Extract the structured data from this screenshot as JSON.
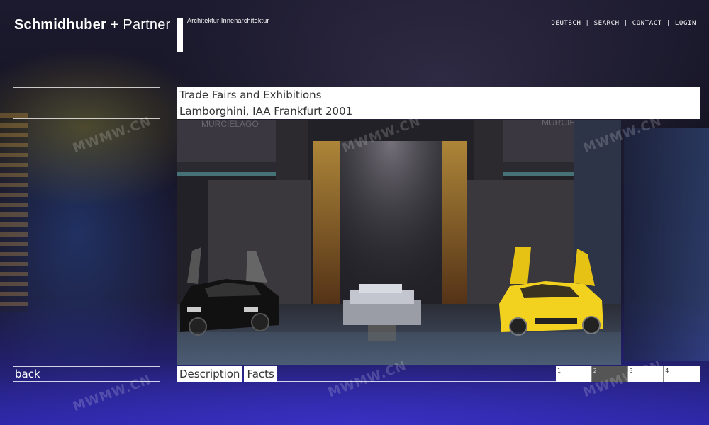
{
  "brand": {
    "name_bold": "Schmidhuber",
    "name_rest": "+ Partner",
    "tagline": "Architektur  Innenarchitektur"
  },
  "nav": {
    "items": [
      "DEUTSCH",
      "SEARCH",
      "CONTACT",
      "LOGIN"
    ],
    "separator": "|"
  },
  "category": "Trade Fairs and Exhibitions",
  "project": "Lamborghini, IAA Frankfurt 2001",
  "photo": {
    "alt": "Lamborghini",
    "signs": [
      "MURCIELAGO",
      "MURCIELAGO"
    ]
  },
  "sidebar": {
    "back_label": "back"
  },
  "tabs": [
    {
      "label": "Description"
    },
    {
      "label": "Facts"
    }
  ],
  "pages": [
    {
      "label": "1"
    },
    {
      "label": "2",
      "active": true
    },
    {
      "label": "3"
    },
    {
      "label": "4"
    }
  ],
  "watermark": "MWMW.CN",
  "colors": {
    "accent_bg": "#ffffff",
    "page_active": "#555555",
    "car_yellow": "#f2d21e"
  }
}
